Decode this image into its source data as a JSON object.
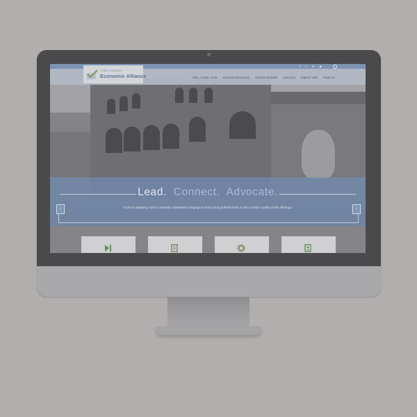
{
  "site": {
    "logo_small": "YORK COUNTY",
    "logo_name": "Economic Alliance",
    "brand_color": "#5d7597",
    "accent_color": "#7d93b2"
  },
  "social_icons": [
    "facebook-icon",
    "twitter-icon",
    "linkedin-icon",
    "youtube-icon"
  ],
  "nav": {
    "items": [
      {
        "label": "Start, Locate, Grow"
      },
      {
        "label": "Business Resources"
      },
      {
        "label": "Member Benefits"
      },
      {
        "label": "Advocacy"
      },
      {
        "label": "Explore York"
      },
      {
        "label": "About Us"
      }
    ]
  },
  "hero": {
    "headline_word1": "Lead.",
    "headline_word2": "Connect.",
    "headline_word3": "Advocate.",
    "caption": "YCEA is adapting York's Creativity Unleashed campaign to sell young professionals on the county's quality-of-life offerings."
  },
  "cards": [
    {
      "icon": "play-icon"
    },
    {
      "icon": "book-icon"
    },
    {
      "icon": "gear-icon"
    },
    {
      "icon": "document-icon"
    }
  ]
}
